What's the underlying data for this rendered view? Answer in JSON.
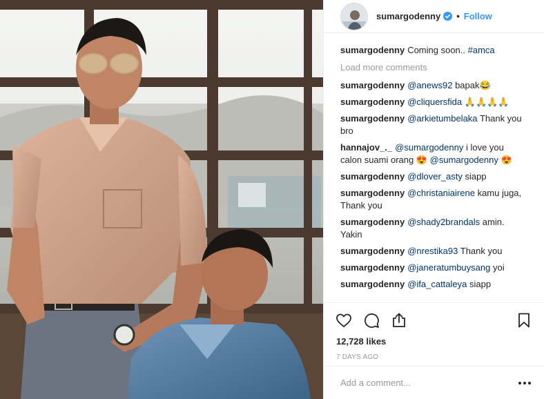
{
  "post": {
    "author": "sumargodenny",
    "follow_label": "Follow",
    "separator": "•",
    "verified": true
  },
  "caption": {
    "user": "sumargodenny",
    "text": "Coming soon..",
    "hashtag": "#amca"
  },
  "load_more_label": "Load more comments",
  "comments": [
    {
      "user": "sumargodenny",
      "mention": "@anews92",
      "text": "bapak😂"
    },
    {
      "user": "sumargodenny",
      "mention": "@cliquersfida",
      "text": "🙏🙏🙏🙏"
    },
    {
      "user": "sumargodenny",
      "mention": "@arkietumbelaka",
      "text": "Thank you bro"
    },
    {
      "user": "hannajov_._",
      "mention": "@sumargodenny",
      "text": "i love you calon suami orang 😍",
      "mention2": "@sumargodenny",
      "text2": "😍"
    },
    {
      "user": "sumargodenny",
      "mention": "@dlover_asty",
      "text": "siapp"
    },
    {
      "user": "sumargodenny",
      "mention": "@christaniairene",
      "text": "kamu juga, Thank you"
    },
    {
      "user": "sumargodenny",
      "mention": "@shady2brandals",
      "text": "amin. Yakin"
    },
    {
      "user": "sumargodenny",
      "mention": "@nrestika93",
      "text": "Thank you"
    },
    {
      "user": "sumargodenny",
      "mention": "@janeratumbuysang",
      "text": "yoi"
    },
    {
      "user": "sumargodenny",
      "mention": "@ifa_cattaleya",
      "text": "siapp"
    }
  ],
  "likes": "12,728 likes",
  "timestamp": "7 DAYS AGO",
  "add_comment_placeholder": "Add a comment...",
  "icons": {
    "like": "heart-icon",
    "comment": "comment-icon",
    "share": "share-icon",
    "save": "bookmark-icon",
    "more": "more-options-icon",
    "verified": "verified-badge-icon"
  },
  "colors": {
    "link": "#3897f0",
    "mention": "#003569",
    "muted": "#999999",
    "text": "#262626",
    "border": "#efefef"
  }
}
